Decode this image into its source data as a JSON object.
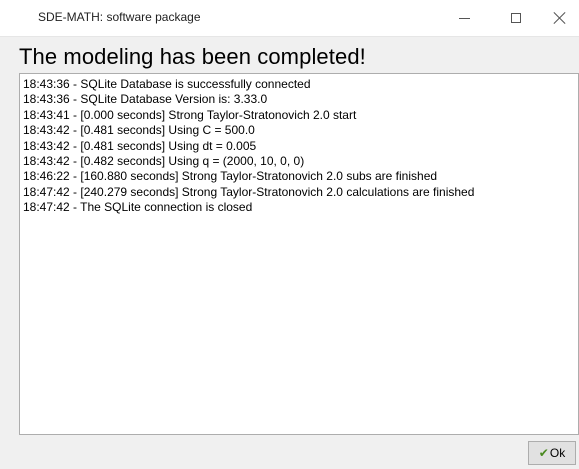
{
  "window": {
    "title": "SDE-MATH: software package",
    "controls": [
      "minimize-icon",
      "maximize-icon",
      "close-icon"
    ]
  },
  "heading": "The modeling has been completed!",
  "log": {
    "lines": [
      "18:43:36 - SQLite Database is successfully connected",
      "18:43:36 - SQLite Database Version is: 3.33.0",
      "18:43:41 - [0.000 seconds] Strong Taylor-Stratonovich 2.0 start",
      "18:43:42 - [0.481 seconds] Using C = 500.0",
      "18:43:42 - [0.481 seconds] Using dt = 0.005",
      "18:43:42 - [0.482 seconds] Using q = (2000, 10, 0, 0)",
      "18:46:22 - [160.880 seconds] Strong Taylor-Stratonovich 2.0 subs are finished",
      "18:47:42 - [240.279 seconds] Strong Taylor-Stratonovich 2.0 calculations are finished",
      "18:47:42 - The SQLite connection is closed"
    ]
  },
  "ok_button": {
    "icon": "check-icon",
    "label": "Ok"
  },
  "colors": {
    "check": "#4a8a20",
    "background": "#f0f0f0"
  }
}
